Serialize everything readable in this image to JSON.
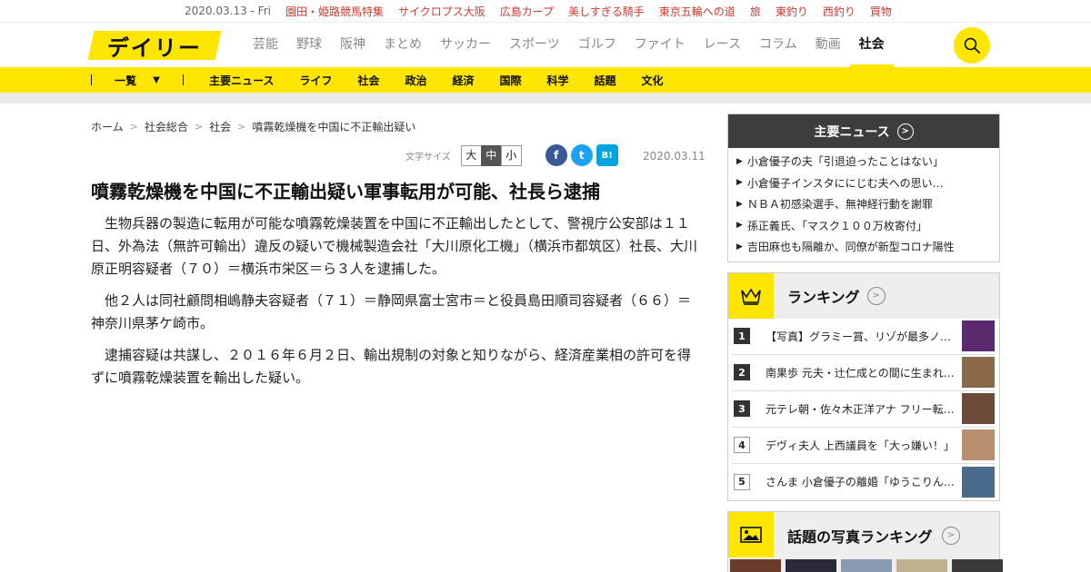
{
  "topstrip": {
    "date": "2020.03.13 - Fri",
    "links": [
      "園田・姫路競馬特集",
      "サイクロプス大阪",
      "広島カープ",
      "美しすぎる騎手",
      "東京五輪への道",
      "旅",
      "東釣り",
      "西釣り",
      "買物"
    ]
  },
  "header": {
    "logo": "デイリー",
    "nav": [
      "芸能",
      "野球",
      "阪神",
      "まとめ",
      "サッカー",
      "スポーツ",
      "ゴルフ",
      "ファイト",
      "レース",
      "コラム",
      "動画",
      "社会"
    ],
    "active": "社会",
    "search_icon": "search-icon"
  },
  "subnav": {
    "ichiran": "一覧",
    "dropdown_icon": "▼",
    "items": [
      "主要ニュース",
      "ライフ",
      "社会",
      "政治",
      "経済",
      "国際",
      "科学",
      "話題",
      "文化"
    ]
  },
  "breadcrumb": [
    "ホーム",
    "社会総合",
    "社会",
    "噴霧乾燥機を中国に不正輸出疑い"
  ],
  "fontsize": {
    "label": "文字サイズ",
    "options": [
      "大",
      "中",
      "小"
    ],
    "selected": "中"
  },
  "share": {
    "facebook": {
      "glyph": "f",
      "color": "#3b5998"
    },
    "twitter": {
      "glyph": "t",
      "color": "#1da1f2"
    },
    "hatena": {
      "glyph": "B!",
      "color": "#00a4de"
    }
  },
  "article": {
    "date": "2020.03.11",
    "title": "噴霧乾燥機を中国に不正輸出疑い軍事転用が可能、社長ら逮捕",
    "paragraphs": [
      "生物兵器の製造に転用が可能な噴霧乾燥装置を中国に不正輸出したとして、警視庁公安部は１１日、外為法（無許可輸出）違反の疑いで機械製造会社「大川原化工機」（横浜市都筑区）社長、大川原正明容疑者（７０）＝横浜市栄区＝ら３人を逮捕した。",
      "他２人は同社顧問相嶋静夫容疑者（７１）＝静岡県富士宮市＝と役員島田順司容疑者（６６）＝神奈川県茅ケ崎市。",
      "逮捕容疑は共謀し、２０１６年６月２日、輸出規制の対象と知りながら、経済産業相の許可を得ずに噴霧乾燥装置を輸出した疑い。"
    ]
  },
  "sidebar": {
    "news": {
      "title": "主要ニュース",
      "items": [
        "小倉優子の夫「引退迫ったことはない」",
        "小倉優子インスタににじむ夫への思い…",
        "ＮＢＡ初感染選手、無神経行動を謝罪",
        "孫正義氏、「マスク１００万枚寄付」",
        "吉田麻也も隔離か、同僚が新型コロナ陽性"
      ]
    },
    "ranking": {
      "title": "ランキング",
      "items": [
        {
          "rank": "1",
          "text": "【写真】グラミー賞、リゾが最多ノミネート…",
          "thumb": "#5a2a6e"
        },
        {
          "rank": "2",
          "text": "南果歩 元夫・辻仁成との間に生まれた…",
          "thumb": "#8a6a4a"
        },
        {
          "rank": "3",
          "text": "元テレ朝・佐々木正洋アナ フリー転身…",
          "thumb": "#6b4a3a"
        },
        {
          "rank": "4",
          "text": "デヴィ夫人 上西議員を「大っ嫌い！」",
          "thumb": "#b89070"
        },
        {
          "rank": "5",
          "text": "さんま 小倉優子の離婚「ゆうこりんは…",
          "thumb": "#4a6a8a"
        }
      ]
    },
    "photo_ranking": {
      "title": "話題の写真ランキング",
      "thumbs": [
        "#6a3a2a",
        "#2a2a3a",
        "#8a9ab0",
        "#c0b090",
        "#3a3a3a"
      ]
    }
  }
}
